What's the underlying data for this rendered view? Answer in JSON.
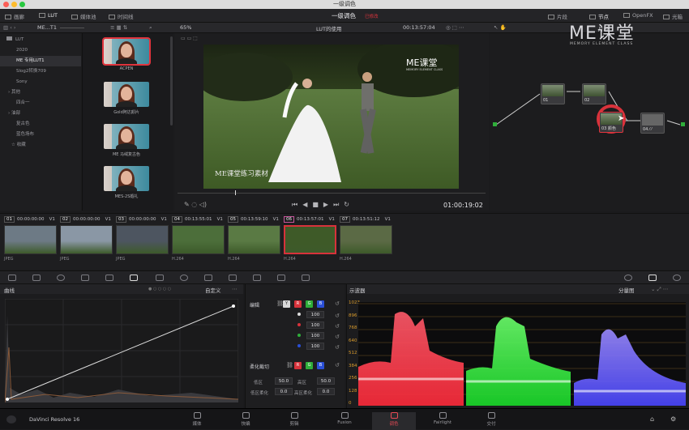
{
  "window": {
    "title": "一级调色"
  },
  "topbar": {
    "media_pool": "画廊",
    "lut": "LUT",
    "media": "媒体池",
    "timeline": "时间线",
    "project_title": "一级调色",
    "project_status": "已修改",
    "clips": "片段",
    "nodes": "节点",
    "openfx": "OpenFX",
    "lightbox": "光箱"
  },
  "subbar": {
    "folder": "ME...T1",
    "zoom": "65%",
    "viewer_title": "LUT的使用",
    "timecode": "00:13:57:04",
    "node_mode": "片段"
  },
  "sidebar": {
    "items": [
      {
        "label": "LUT",
        "selected": false,
        "icon": "folder-icon"
      },
      {
        "label": "2020",
        "selected": false,
        "icon": ""
      },
      {
        "label": "ME 专用LUT1",
        "selected": true,
        "icon": ""
      },
      {
        "label": "Slog2转换709",
        "selected": false,
        "icon": ""
      },
      {
        "label": "Sony",
        "selected": false,
        "icon": ""
      },
      {
        "label": "其他",
        "selected": false,
        "icon": "chevron-right-icon"
      },
      {
        "label": "四合一",
        "selected": false,
        "icon": ""
      },
      {
        "label": "油部",
        "selected": false,
        "icon": "chevron-right-icon"
      },
      {
        "label": "复古色",
        "selected": false,
        "icon": ""
      },
      {
        "label": "蓝色场布",
        "selected": false,
        "icon": ""
      },
      {
        "label": "收藏",
        "selected": false,
        "icon": "star-icon"
      }
    ]
  },
  "luts": [
    {
      "label": "ACPEN",
      "selected": true
    },
    {
      "label": "Gold阿达颜片",
      "selected": false
    },
    {
      "label": "ME 马绒复古色",
      "selected": false
    },
    {
      "label": "MES-2S婚礼",
      "selected": false
    }
  ],
  "viewer": {
    "watermark_top": "ME课堂",
    "watermark_sub": "MEMORY ELEMENT CLASS",
    "caption": "ME课堂练习素材",
    "play_timecode": "01:00:19:02"
  },
  "nodes": {
    "brand": "ME课堂",
    "brand_sub": "MEMORY ELEMENT CLASS",
    "node1": "01",
    "node2": "02",
    "node3": "03 颜色",
    "node4": "04 ⁄ ⁄"
  },
  "clips": [
    {
      "num": "01",
      "tc": "00:00:00:00",
      "track": "V1",
      "codec": "JPEG",
      "selected": false
    },
    {
      "num": "02",
      "tc": "00:00:00:00",
      "track": "V1",
      "codec": "JPEG",
      "selected": false
    },
    {
      "num": "03",
      "tc": "00:00:00:00",
      "track": "V1",
      "codec": "JPEG",
      "selected": false
    },
    {
      "num": "04",
      "tc": "00:13:55:01",
      "track": "V1",
      "codec": "H.264",
      "selected": false
    },
    {
      "num": "05",
      "tc": "00:13:59:10",
      "track": "V1",
      "codec": "H.264",
      "selected": false
    },
    {
      "num": "06",
      "tc": "00:13:57:01",
      "track": "V1",
      "codec": "H.264",
      "selected": true
    },
    {
      "num": "07",
      "tc": "00:13:51:12",
      "track": "V1",
      "codec": "H.264",
      "selected": false
    }
  ],
  "curves": {
    "title": "曲线",
    "mode": "自定义"
  },
  "edit": {
    "title": "编辑",
    "y_label": "Y",
    "r_label": "R",
    "g_label": "G",
    "b_label": "B",
    "values": [
      "100",
      "100",
      "100",
      "100"
    ],
    "soft_clip": "柔化截切",
    "low_label": "低区",
    "low_val": "50.0",
    "high_label": "高区",
    "high_val": "50.0",
    "low_soft_label": "低区柔化",
    "low_soft_val": "0.0",
    "high_soft_label": "高区柔化",
    "high_soft_val": "0.0"
  },
  "scope": {
    "title": "示波器",
    "mode": "分量图",
    "ticks": [
      "1023",
      "896",
      "768",
      "640",
      "512",
      "384",
      "256",
      "128",
      "0"
    ]
  },
  "bottombar": {
    "app": "DaVinci Resolve 16",
    "pages": [
      {
        "label": "媒体",
        "selected": false
      },
      {
        "label": "快编",
        "selected": false
      },
      {
        "label": "剪辑",
        "selected": false
      },
      {
        "label": "Fusion",
        "selected": false
      },
      {
        "label": "调色",
        "selected": true
      },
      {
        "label": "Fairlight",
        "selected": false
      },
      {
        "label": "交付",
        "selected": false
      }
    ]
  },
  "colors": {
    "accent": "#e0343d",
    "red": "#d8323b",
    "green": "#2fae3a",
    "blue": "#2a4fd6"
  }
}
